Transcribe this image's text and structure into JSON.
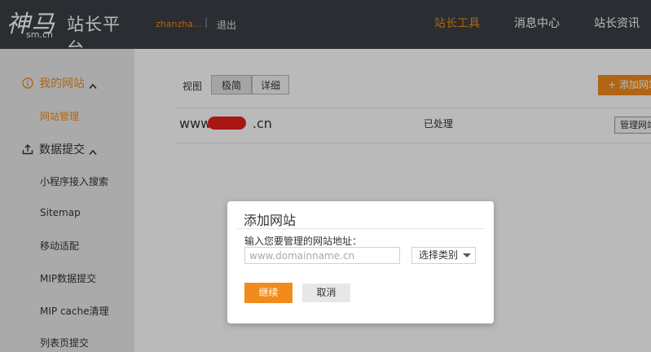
{
  "header": {
    "logo_mark": "神马",
    "logo_domain": "sm.cn",
    "logo_title": "站长平台",
    "user_name": "zhanzha...",
    "separator": "|",
    "logout": "退出",
    "nav": [
      "站长工具",
      "消息中心",
      "站长资讯"
    ],
    "active_nav": "站长工具"
  },
  "sidebar": {
    "sections": [
      {
        "label": "我的网站",
        "icon": "info-circle-icon"
      },
      {
        "label": "数据提交",
        "icon": "upload-icon"
      }
    ],
    "items": [
      "网站管理",
      "小程序接入搜索",
      "Sitemap",
      "移动适配",
      "MIP数据提交",
      "MIP cache清理",
      "列表页提交"
    ]
  },
  "main": {
    "view_label": "视图",
    "view_options": [
      "极简",
      "详细"
    ],
    "add_button": "+ 添加网站",
    "site": {
      "url_prefix": "www.",
      "url_suffix": ".cn",
      "status": "已处理",
      "manage_label": "管理网站"
    }
  },
  "modal": {
    "title": "添加网站",
    "label": "输入您要管理的网站地址：",
    "input_placeholder": "www.domainname.cn",
    "input_value": "",
    "category_selected": "选择类别",
    "continue_label": "继续",
    "cancel_label": "取消"
  },
  "colors": {
    "accent": "#f08b1c",
    "header_bg": "#3a3e44",
    "sidebar_bg": "#e9e9e9",
    "redaction": "#e8201e"
  }
}
